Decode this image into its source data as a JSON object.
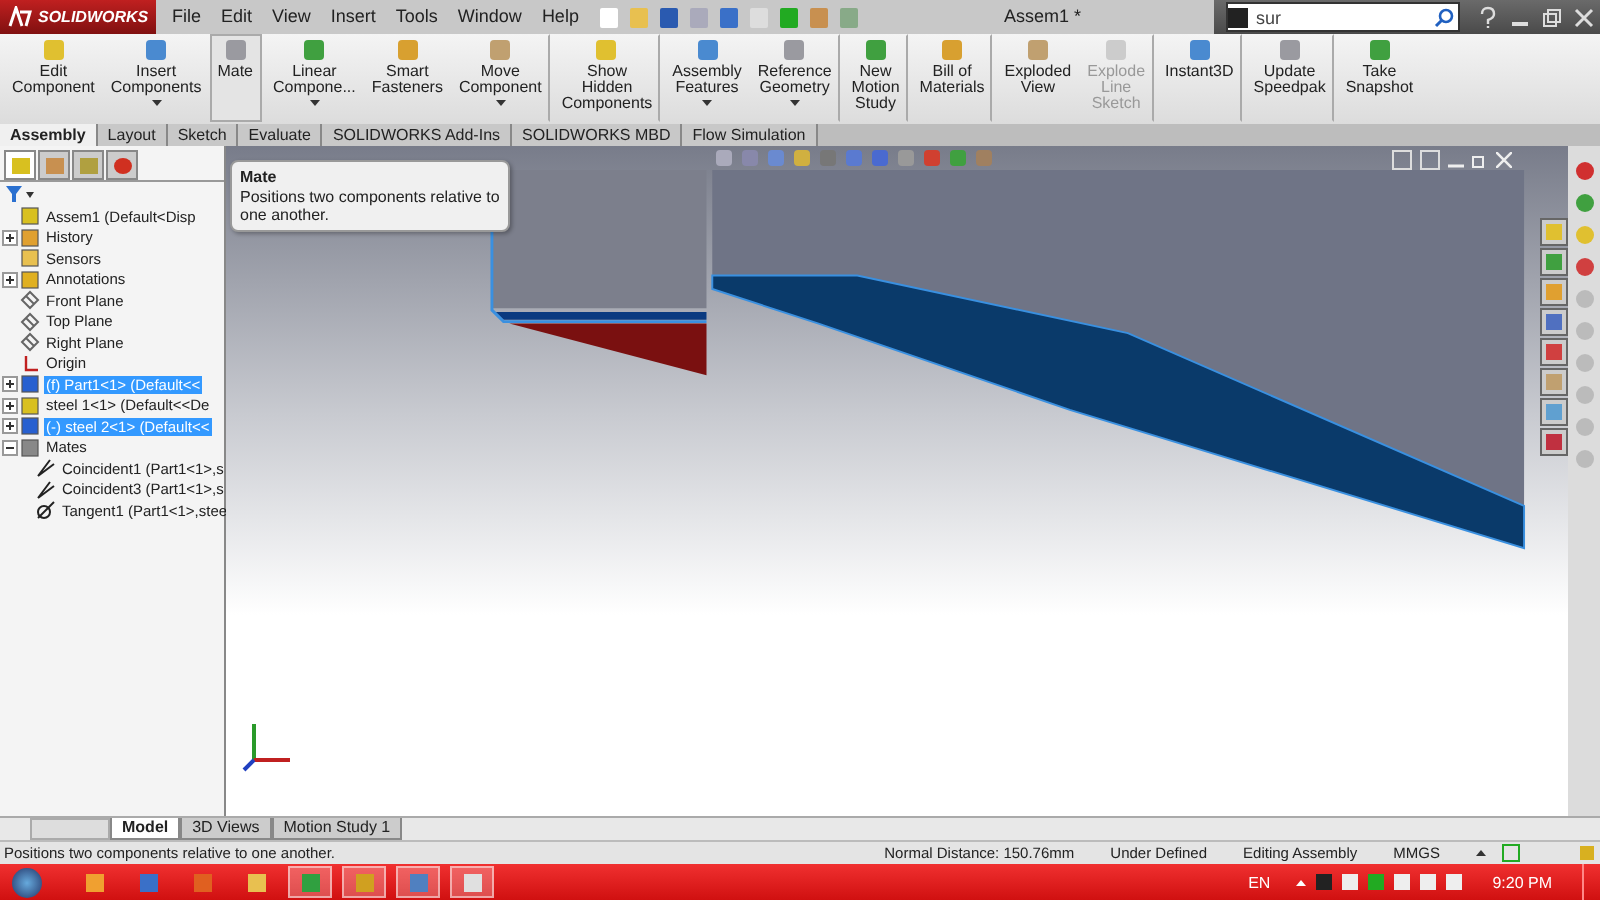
{
  "app": {
    "logo_text": "SOLIDWORKS",
    "menu": [
      "File",
      "Edit",
      "View",
      "Insert",
      "Tools",
      "Window",
      "Help"
    ],
    "title": "Assem1 *",
    "search": {
      "value": "sur"
    }
  },
  "ribbon": [
    {
      "lines": [
        "Edit",
        "Component"
      ],
      "dropdown": false,
      "disabled": false,
      "selected": false,
      "separator_after": false
    },
    {
      "lines": [
        "Insert",
        "Components"
      ],
      "dropdown": true,
      "disabled": false,
      "selected": false,
      "separator_after": false
    },
    {
      "lines": [
        "Mate"
      ],
      "dropdown": false,
      "disabled": false,
      "selected": true,
      "separator_after": true
    },
    {
      "lines": [
        "Linear",
        "Compone..."
      ],
      "dropdown": true,
      "disabled": false,
      "selected": false,
      "separator_after": false
    },
    {
      "lines": [
        "Smart",
        "Fasteners"
      ],
      "dropdown": false,
      "disabled": false,
      "selected": false,
      "separator_after": false
    },
    {
      "lines": [
        "Move",
        "Component"
      ],
      "dropdown": true,
      "disabled": false,
      "selected": false,
      "separator_after": true
    },
    {
      "lines": [
        "Show",
        "Hidden",
        "Components"
      ],
      "dropdown": false,
      "disabled": false,
      "selected": false,
      "separator_after": true
    },
    {
      "lines": [
        "Assembly",
        "Features"
      ],
      "dropdown": true,
      "disabled": false,
      "selected": false,
      "separator_after": false
    },
    {
      "lines": [
        "Reference",
        "Geometry"
      ],
      "dropdown": true,
      "disabled": false,
      "selected": false,
      "separator_after": true
    },
    {
      "lines": [
        "New",
        "Motion",
        "Study"
      ],
      "dropdown": false,
      "disabled": false,
      "selected": false,
      "separator_after": true
    },
    {
      "lines": [
        "Bill of",
        "Materials"
      ],
      "dropdown": false,
      "disabled": false,
      "selected": false,
      "separator_after": true
    },
    {
      "lines": [
        "Exploded",
        "View"
      ],
      "dropdown": false,
      "disabled": false,
      "selected": false,
      "separator_after": false
    },
    {
      "lines": [
        "Explode",
        "Line",
        "Sketch"
      ],
      "dropdown": false,
      "disabled": true,
      "selected": false,
      "separator_after": true
    },
    {
      "lines": [
        "Instant3D"
      ],
      "dropdown": false,
      "disabled": false,
      "selected": false,
      "separator_after": true
    },
    {
      "lines": [
        "Update",
        "Speedpak"
      ],
      "dropdown": false,
      "disabled": false,
      "selected": false,
      "separator_after": true
    },
    {
      "lines": [
        "Take",
        "Snapshot"
      ],
      "dropdown": false,
      "disabled": false,
      "selected": false,
      "separator_after": false
    }
  ],
  "tabs": [
    {
      "label": "Assembly",
      "selected": true
    },
    {
      "label": "Layout",
      "selected": false
    },
    {
      "label": "Sketch",
      "selected": false
    },
    {
      "label": "Evaluate",
      "selected": false
    },
    {
      "label": "SOLIDWORKS Add-Ins",
      "selected": false
    },
    {
      "label": "SOLIDWORKS MBD",
      "selected": false
    },
    {
      "label": "Flow Simulation",
      "selected": false
    }
  ],
  "tooltip": {
    "title": "Mate",
    "text": "Positions two components relative to one another."
  },
  "tree": [
    {
      "label": "Assem1  (Default<Disp",
      "kind": "assembly",
      "selected": false
    },
    {
      "label": "History",
      "kind": "history",
      "selected": false,
      "expanded": false
    },
    {
      "label": "Sensors",
      "kind": "sensors",
      "selected": false
    },
    {
      "label": "Annotations",
      "kind": "annotations",
      "selected": false,
      "expanded": false
    },
    {
      "label": "Front Plane",
      "kind": "plane",
      "selected": false
    },
    {
      "label": "Top Plane",
      "kind": "plane",
      "selected": false
    },
    {
      "label": "Right Plane",
      "kind": "plane",
      "selected": false
    },
    {
      "label": "Origin",
      "kind": "origin",
      "selected": false
    },
    {
      "label": "(f) Part1<1>  (Default<<",
      "kind": "part",
      "selected": true,
      "expanded": false
    },
    {
      "label": "steel 1<1>  (Default<<De",
      "kind": "part-edit",
      "selected": false,
      "expanded": false
    },
    {
      "label": "(-) steel 2<1>  (Default<<",
      "kind": "part",
      "selected": true,
      "expanded": false
    },
    {
      "label": "Mates",
      "kind": "mates",
      "selected": false,
      "expanded": true,
      "children": [
        {
          "label": "Coincident1 (Part1<1>,s",
          "kind": "coincident",
          "selected": false
        },
        {
          "label": "Coincident3 (Part1<1>,s",
          "kind": "coincident",
          "selected": false
        },
        {
          "label": "Tangent1 (Part1<1>,stee",
          "kind": "tangent",
          "selected": false
        }
      ]
    }
  ],
  "bottom_tabs": [
    {
      "label": "Model",
      "selected": true
    },
    {
      "label": "3D Views",
      "selected": false
    },
    {
      "label": "Motion Study 1",
      "selected": false
    }
  ],
  "status_bar": {
    "message": "Positions two components relative to one another.",
    "fields": [
      "Normal Distance: 150.76mm",
      "Under Defined",
      "Editing Assembly",
      "MMGS"
    ]
  },
  "taskbar": {
    "language": "EN",
    "time": "9:20 PM"
  }
}
